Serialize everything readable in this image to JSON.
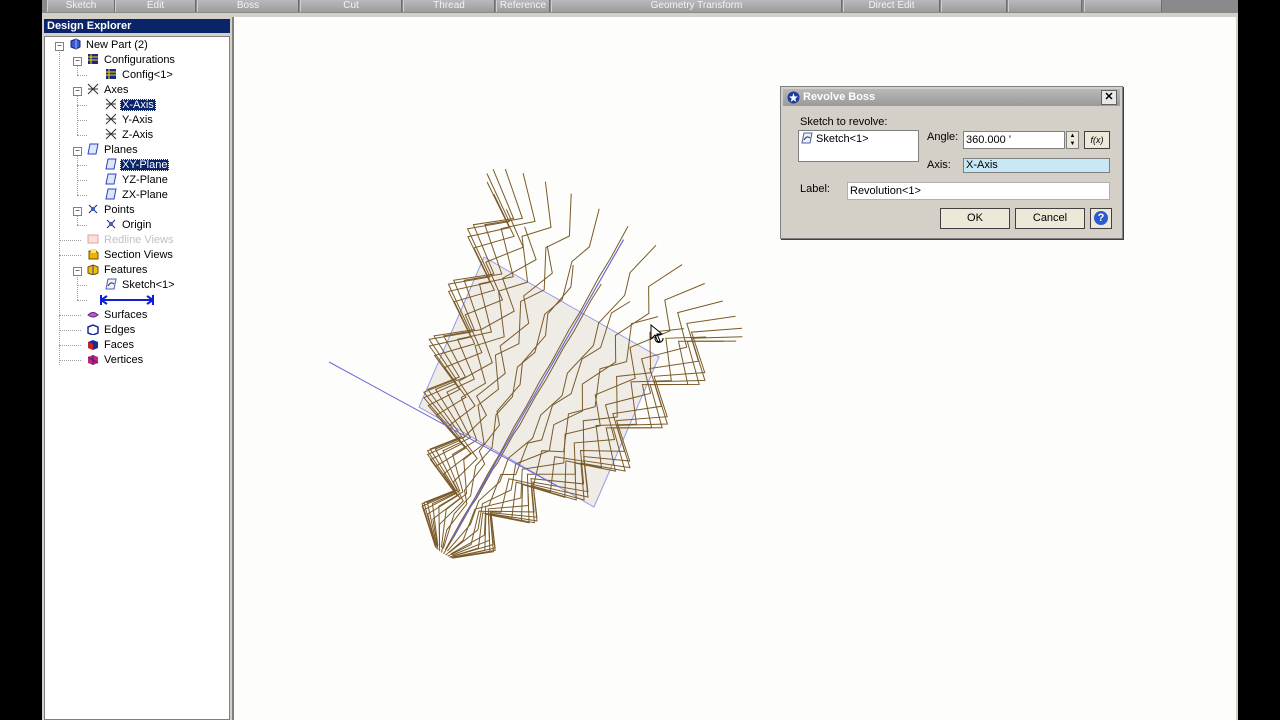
{
  "toolbar": {
    "items": [
      "Sketch",
      "Edit",
      "Boss",
      "Cut",
      "Thread",
      "Reference",
      "Geometry Transform",
      "Direct Edit",
      "",
      "",
      ""
    ]
  },
  "explorer": {
    "title": "Design Explorer",
    "tree": {
      "root": "New Part (2)",
      "configurations": "Configurations",
      "config1": "Config<1>",
      "axes": "Axes",
      "x_axis": "X-Axis",
      "y_axis": "Y-Axis",
      "z_axis": "Z-Axis",
      "planes": "Planes",
      "xy_plane": "XY-Plane",
      "yz_plane": "YZ-Plane",
      "zx_plane": "ZX-Plane",
      "points": "Points",
      "origin": "Origin",
      "redline_views": "Redline Views",
      "section_views": "Section Views",
      "features": "Features",
      "sketch1": "Sketch<1>",
      "surfaces": "Surfaces",
      "edges": "Edges",
      "faces": "Faces",
      "vertices": "Vertices"
    }
  },
  "dialog": {
    "title": "Revolve Boss",
    "sketch_label": "Sketch to revolve:",
    "sketch_item": "Sketch<1>",
    "angle_label": "Angle:",
    "angle_value": "360.000 '",
    "fx_label": "f(x)",
    "axis_label": "Axis:",
    "axis_value": "X-Axis",
    "label_label": "Label:",
    "label_value": "Revolution<1>",
    "ok": "OK",
    "cancel": "Cancel",
    "help": "?"
  },
  "colors": {
    "wire": "#7a5a2a",
    "axis_line": "#6a6ad8",
    "selection": "#0a246a"
  }
}
